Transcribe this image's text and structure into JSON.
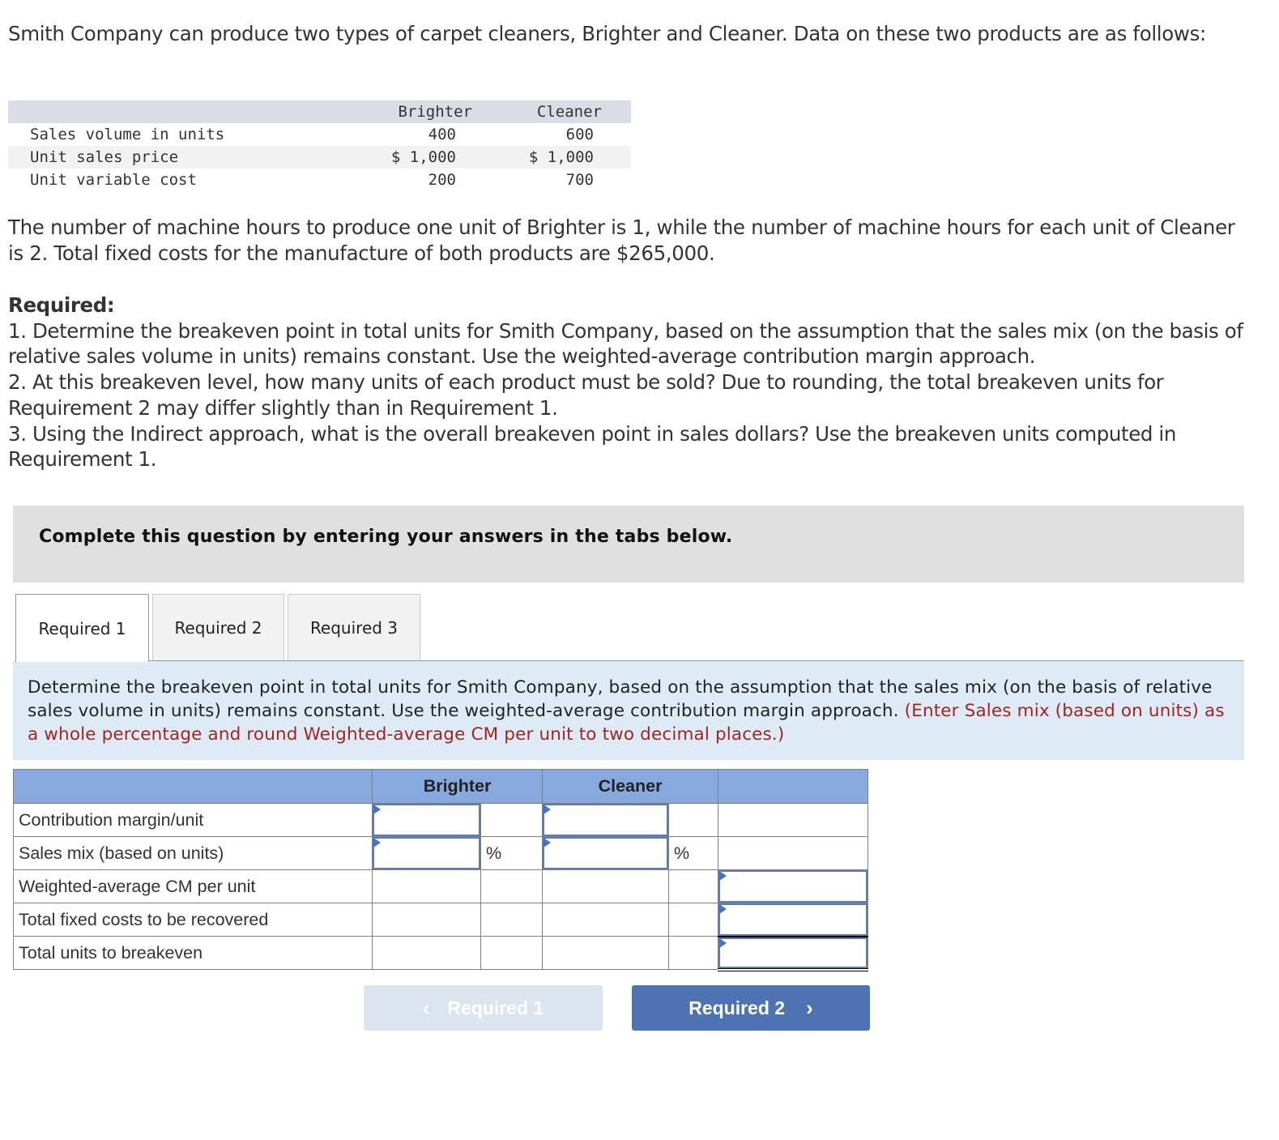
{
  "intro": "Smith Company can produce two types of carpet cleaners, Brighter and Cleaner. Data on these two products are as follows:",
  "data_table": {
    "headers": [
      "",
      "Brighter",
      "Cleaner"
    ],
    "rows": [
      {
        "label": "Sales volume in units",
        "brighter": "400",
        "cleaner": "600"
      },
      {
        "label": "Unit sales price",
        "brighter": "$ 1,000",
        "cleaner": "$ 1,000"
      },
      {
        "label": "Unit variable cost",
        "brighter": "200",
        "cleaner": "700"
      }
    ]
  },
  "paragraph2": "The number of machine hours to produce one unit of Brighter is 1, while the number of machine hours for each unit of Cleaner is 2. Total fixed costs for the manufacture of both products are $265,000.",
  "required": {
    "title": "Required:",
    "items": [
      "1. Determine the breakeven point in total units for Smith Company, based on the assumption that the sales mix (on the basis of relative sales volume in units) remains constant. Use the weighted-average contribution margin approach.",
      "2. At this breakeven level, how many units of each product must be sold? Due to rounding, the total breakeven units for Requirement 2 may differ slightly than in Requirement 1.",
      "3. Using the Indirect approach, what is the overall breakeven point in sales dollars? Use the breakeven units computed in Requirement 1."
    ]
  },
  "banner": "Complete this question by entering your answers in the tabs below.",
  "tabs": [
    {
      "label": "Required 1",
      "active": true
    },
    {
      "label": "Required 2",
      "active": false
    },
    {
      "label": "Required 3",
      "active": false
    }
  ],
  "instruction": {
    "text": "Determine the breakeven point in total units for Smith Company, based on the assumption that the sales mix (on the basis of relative sales volume in units) remains constant. Use the weighted-average contribution margin approach.",
    "note": "(Enter Sales mix (based on units) as a whole percentage and round Weighted-average CM per unit to two decimal places.)",
    "note_color": "#a0261f"
  },
  "answer_table": {
    "headers": {
      "brighter": "Brighter",
      "cleaner": "Cleaner",
      "total": ""
    },
    "rows": [
      {
        "label": "Contribution margin/unit",
        "brighter": "",
        "cleaner": "",
        "total": ""
      },
      {
        "label": "Sales mix (based on units)",
        "brighter": "",
        "brighter_unit": "%",
        "cleaner": "",
        "cleaner_unit": "%",
        "total": ""
      },
      {
        "label": "Weighted-average CM per unit",
        "total": ""
      },
      {
        "label": "Total fixed costs to be recovered",
        "total": ""
      },
      {
        "label": "Total units to breakeven",
        "total": ""
      }
    ]
  },
  "nav": {
    "prev_label": "Required 1",
    "next_label": "Required 2",
    "prev_icon": "‹",
    "next_icon": "›"
  },
  "colors": {
    "header_blue": "#87a9dd",
    "button_blue": "#4e73b3",
    "button_disabled": "#dbe4ef",
    "instruction_bg": "#deebf7",
    "banner_bg": "#e0e0e0"
  }
}
